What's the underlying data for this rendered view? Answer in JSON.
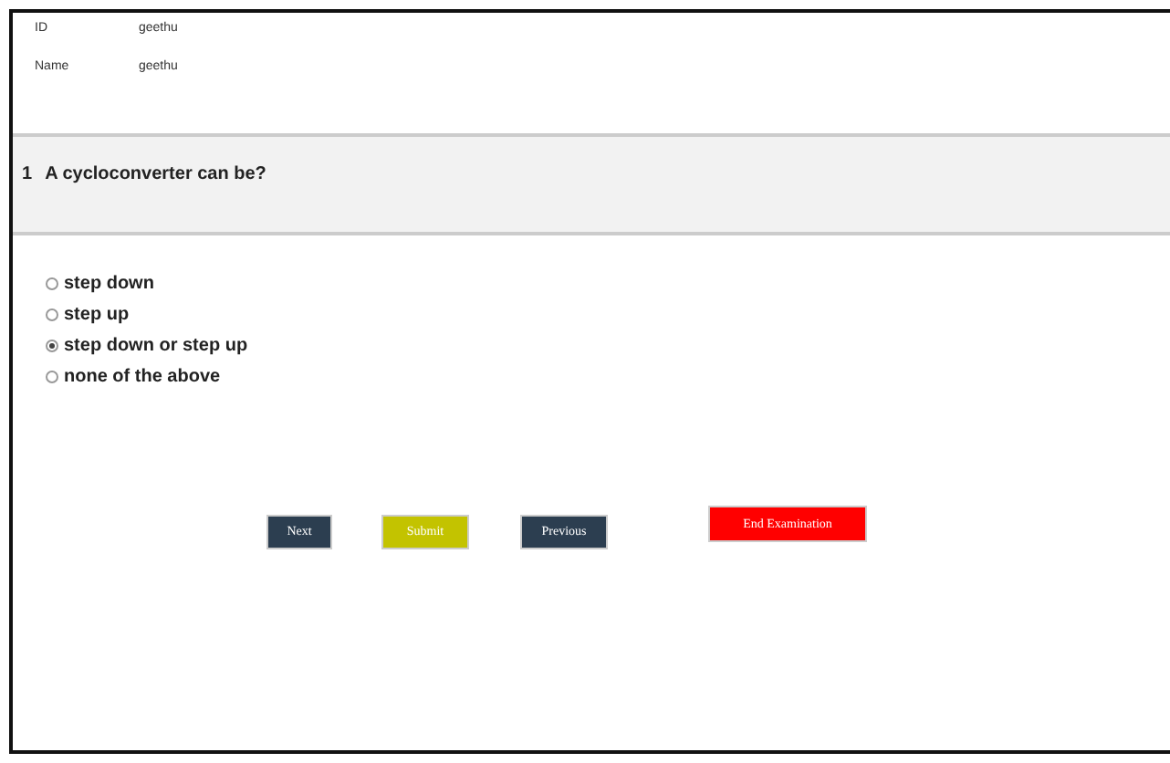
{
  "candidate": [
    {
      "label": "ID",
      "value": "geethu"
    },
    {
      "label": "Name",
      "value": "geethu"
    }
  ],
  "question": {
    "number": "1",
    "text": "A cycloconverter can be?"
  },
  "options": [
    {
      "label": "step down",
      "selected": false
    },
    {
      "label": "step up",
      "selected": false
    },
    {
      "label": "step down or step up",
      "selected": true
    },
    {
      "label": "none of the above",
      "selected": false
    }
  ],
  "buttons": [
    {
      "label": "Next",
      "kind": "nav"
    },
    {
      "label": "Submit",
      "kind": "submit"
    },
    {
      "label": "Previous",
      "kind": "nav"
    },
    {
      "label": "End Examination",
      "kind": "end"
    }
  ]
}
